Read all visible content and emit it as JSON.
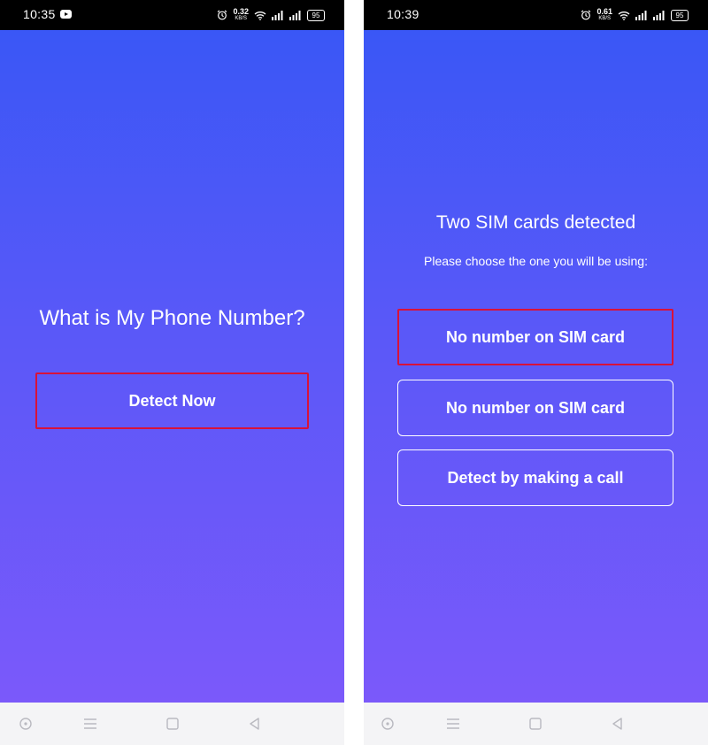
{
  "left_phone": {
    "status": {
      "time": "10:35",
      "speed": "0.32",
      "speed_unit": "KB/S",
      "battery": "95"
    },
    "title": "What is My Phone Number?",
    "detect_button": "Detect Now"
  },
  "right_phone": {
    "status": {
      "time": "10:39",
      "speed": "0.61",
      "speed_unit": "KB/S",
      "battery": "95"
    },
    "title": "Two SIM cards detected",
    "subtitle": "Please choose the one you will be using:",
    "options": [
      {
        "label": "No number on SIM card",
        "highlighted": true
      },
      {
        "label": "No number on SIM card",
        "highlighted": false
      },
      {
        "label": "Detect by making a call",
        "highlighted": false
      }
    ]
  },
  "colors": {
    "gradient_top": "#3a57f6",
    "gradient_bottom": "#7b59fa",
    "highlight": "#d8123a"
  },
  "icons": {
    "status": [
      "youtube-icon",
      "alarm-icon",
      "wifi-icon",
      "signal-icon",
      "battery-icon"
    ],
    "nav": [
      "home-circle-icon",
      "menu-icon",
      "square-icon",
      "back-icon"
    ]
  }
}
